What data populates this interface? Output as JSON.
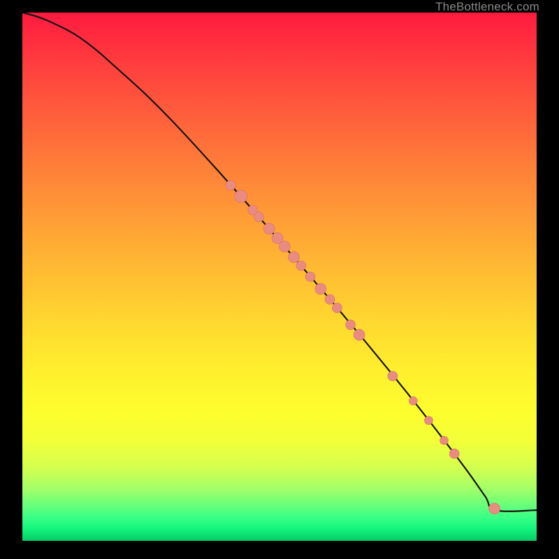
{
  "watermark": "TheBottleneck.com",
  "colors": {
    "background": "#000000",
    "curve": "#141414",
    "marker_fill": "#e98b80",
    "marker_stroke": "#d77066",
    "watermark_text": "#8a8a8a"
  },
  "chart_data": {
    "type": "line",
    "title": "",
    "xlabel": "",
    "ylabel": "",
    "axes_visible": false,
    "grid": false,
    "xlim": [
      0,
      100
    ],
    "ylim": [
      0,
      100
    ],
    "background_gradient": {
      "direction": "vertical",
      "stops": [
        {
          "pos": 0,
          "color": "#ff1a3f"
        },
        {
          "pos": 35,
          "color": "#ff8a38"
        },
        {
          "pos": 70,
          "color": "#fff22c"
        },
        {
          "pos": 92,
          "color": "#8dff6d"
        },
        {
          "pos": 100,
          "color": "#07c963"
        }
      ]
    },
    "series": [
      {
        "name": "curve",
        "kind": "line",
        "x": [
          0,
          3,
          6,
          10,
          14,
          18,
          24,
          30,
          38,
          46,
          54,
          62,
          70,
          78,
          86,
          90,
          92,
          100
        ],
        "y": [
          100,
          99.2,
          98.0,
          96.0,
          93.2,
          89.8,
          84.5,
          78.6,
          70.1,
          61.3,
          52.3,
          43.2,
          33.8,
          24.1,
          13.9,
          8.4,
          5.8,
          5.8
        ]
      },
      {
        "name": "markers",
        "kind": "scatter",
        "points": [
          {
            "x": 40.5,
            "y": 67.3,
            "r": 7
          },
          {
            "x": 42.5,
            "y": 65.2,
            "r": 9
          },
          {
            "x": 44.8,
            "y": 62.6,
            "r": 7
          },
          {
            "x": 46.0,
            "y": 61.3,
            "r": 7
          },
          {
            "x": 48.0,
            "y": 59.1,
            "r": 8
          },
          {
            "x": 49.6,
            "y": 57.3,
            "r": 8
          },
          {
            "x": 51.0,
            "y": 55.7,
            "r": 8
          },
          {
            "x": 52.8,
            "y": 53.7,
            "r": 8
          },
          {
            "x": 54.2,
            "y": 52.1,
            "r": 7
          },
          {
            "x": 56.0,
            "y": 50.0,
            "r": 7
          },
          {
            "x": 58.0,
            "y": 47.7,
            "r": 8
          },
          {
            "x": 59.8,
            "y": 45.7,
            "r": 7
          },
          {
            "x": 61.2,
            "y": 44.1,
            "r": 7
          },
          {
            "x": 63.8,
            "y": 40.9,
            "r": 7
          },
          {
            "x": 65.5,
            "y": 39.0,
            "r": 8
          },
          {
            "x": 72.0,
            "y": 31.2,
            "r": 7
          },
          {
            "x": 76.0,
            "y": 26.5,
            "r": 6
          },
          {
            "x": 79.0,
            "y": 22.8,
            "r": 6
          },
          {
            "x": 82.0,
            "y": 19.0,
            "r": 6
          },
          {
            "x": 84.0,
            "y": 16.5,
            "r": 7
          },
          {
            "x": 91.8,
            "y": 6.1,
            "r": 8
          }
        ]
      }
    ]
  }
}
